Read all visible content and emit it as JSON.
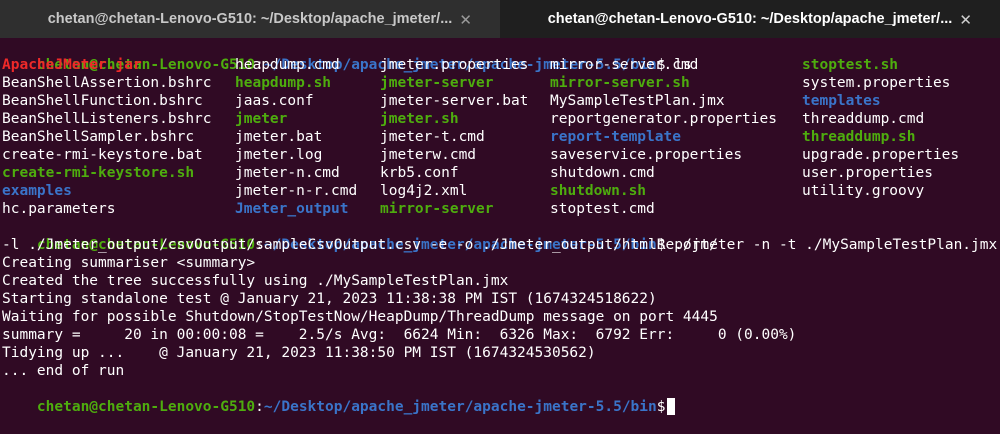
{
  "window": {
    "tabs": [
      {
        "title": "chetan@chetan-Lenovo-G510: ~/Desktop/apache_jmeter/...",
        "active": false
      },
      {
        "title": "chetan@chetan-Lenovo-G510: ~/Desktop/apache_jmeter/...",
        "active": true
      }
    ],
    "close_glyph": "✕"
  },
  "prompt": {
    "user_host": "chetan@chetan-Lenovo-G510",
    "separator": ":",
    "path": "~/Desktop/apache_jmeter/apache-jmeter-5.5/bin",
    "dollar": "$"
  },
  "commands": {
    "ls": " ls",
    "jmeter": " ./jmeter -n -t ./MySampleTestPlan.jmx",
    "jmeter_cont": "-l ./Jmeter_output/csvOutput/sampleCsvOutput.csv -e -o ./Jmeter_output/htmlReport/"
  },
  "ls_columns": [
    [
      {
        "name": "ApacheJMeter.jar",
        "color": "red"
      },
      {
        "name": "BeanShellAssertion.bshrc",
        "color": "white"
      },
      {
        "name": "BeanShellFunction.bshrc",
        "color": "white"
      },
      {
        "name": "BeanShellListeners.bshrc",
        "color": "white"
      },
      {
        "name": "BeanShellSampler.bshrc",
        "color": "white"
      },
      {
        "name": "create-rmi-keystore.bat",
        "color": "white"
      },
      {
        "name": "create-rmi-keystore.sh",
        "color": "green"
      },
      {
        "name": "examples",
        "color": "blue"
      },
      {
        "name": "hc.parameters",
        "color": "white"
      }
    ],
    [
      {
        "name": "heapdump.cmd",
        "color": "white"
      },
      {
        "name": "heapdump.sh",
        "color": "green"
      },
      {
        "name": "jaas.conf",
        "color": "white"
      },
      {
        "name": "jmeter",
        "color": "green"
      },
      {
        "name": "jmeter.bat",
        "color": "white"
      },
      {
        "name": "jmeter.log",
        "color": "white"
      },
      {
        "name": "jmeter-n.cmd",
        "color": "white"
      },
      {
        "name": "jmeter-n-r.cmd",
        "color": "white"
      },
      {
        "name": "Jmeter_output",
        "color": "blue"
      }
    ],
    [
      {
        "name": "jmeter.properties",
        "color": "white"
      },
      {
        "name": "jmeter-server",
        "color": "green"
      },
      {
        "name": "jmeter-server.bat",
        "color": "white"
      },
      {
        "name": "jmeter.sh",
        "color": "green"
      },
      {
        "name": "jmeter-t.cmd",
        "color": "white"
      },
      {
        "name": "jmeterw.cmd",
        "color": "white"
      },
      {
        "name": "krb5.conf",
        "color": "white"
      },
      {
        "name": "log4j2.xml",
        "color": "white"
      },
      {
        "name": "mirror-server",
        "color": "green"
      }
    ],
    [
      {
        "name": "mirror-server.cmd",
        "color": "white"
      },
      {
        "name": "mirror-server.sh",
        "color": "green"
      },
      {
        "name": "MySampleTestPlan.jmx",
        "color": "white"
      },
      {
        "name": "reportgenerator.properties",
        "color": "white"
      },
      {
        "name": "report-template",
        "color": "blue"
      },
      {
        "name": "saveservice.properties",
        "color": "white"
      },
      {
        "name": "shutdown.cmd",
        "color": "white"
      },
      {
        "name": "shutdown.sh",
        "color": "green"
      },
      {
        "name": "stoptest.cmd",
        "color": "white"
      }
    ],
    [
      {
        "name": "stoptest.sh",
        "color": "green"
      },
      {
        "name": "system.properties",
        "color": "white"
      },
      {
        "name": "templates",
        "color": "blue"
      },
      {
        "name": "threaddump.cmd",
        "color": "white"
      },
      {
        "name": "threaddump.sh",
        "color": "green"
      },
      {
        "name": "upgrade.properties",
        "color": "white"
      },
      {
        "name": "user.properties",
        "color": "white"
      },
      {
        "name": "utility.groovy",
        "color": "white"
      }
    ]
  ],
  "output_lines": [
    "Creating summariser <summary>",
    "Created the tree successfully using ./MySampleTestPlan.jmx",
    "Starting standalone test @ January 21, 2023 11:38:38 PM IST (1674324518622)",
    "Waiting for possible Shutdown/StopTestNow/HeapDump/ThreadDump message on port 4445",
    "summary =     20 in 00:00:08 =    2.5/s Avg:  6624 Min:  6326 Max:  6792 Err:     0 (0.00%)",
    "Tidying up ...    @ January 21, 2023 11:38:50 PM IST (1674324530562)",
    "... end of run"
  ],
  "colors": {
    "background": "#300a24",
    "prompt_user": "#4ead0e",
    "prompt_path": "#3a74c9",
    "exec_file": "#4ead0e",
    "directory": "#3a74c9",
    "archive": "#ef2929"
  }
}
